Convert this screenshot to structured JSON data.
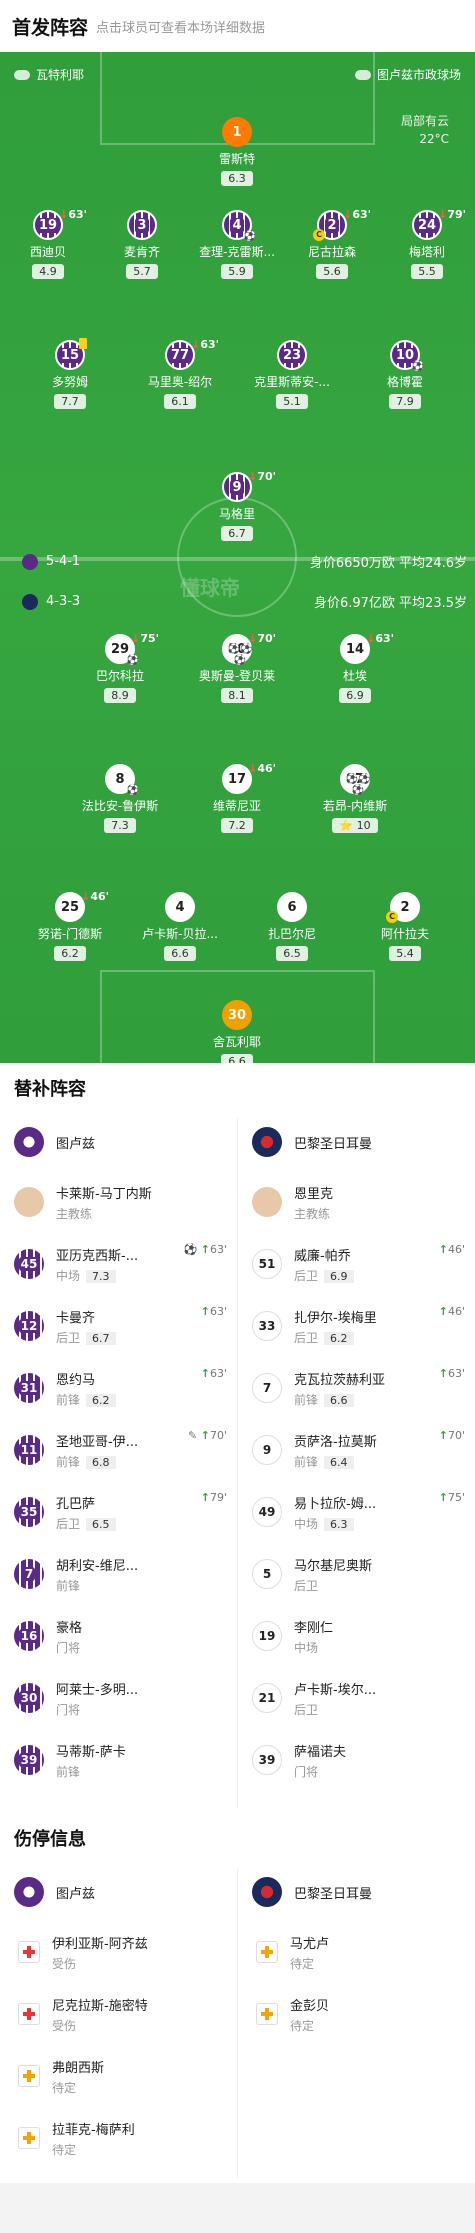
{
  "header": {
    "title": "首发阵容",
    "subtitle": "点击球员可查看本场详细数据"
  },
  "pitch": {
    "referee": "瓦特利耶",
    "stadium": "图卢兹市政球场",
    "weather": "局部有云",
    "temperature": "22°C",
    "watermark": "懂球帝",
    "home": {
      "formation": "5-4-1",
      "value": "身价6650万欧 平均24.6岁"
    },
    "away": {
      "formation": "4-3-3",
      "value": "身价6.97亿欧 平均23.5岁"
    },
    "players": [
      {
        "num": "1",
        "name": "雷斯特",
        "rating": "6.3",
        "kit": "gk1"
      },
      {
        "num": "19",
        "name": "西迪贝",
        "rating": "4.9",
        "kit": "tol",
        "sub": "63'"
      },
      {
        "num": "3",
        "name": "麦肯齐",
        "rating": "5.7",
        "kit": "tol"
      },
      {
        "num": "4",
        "name": "查理-克雷斯...",
        "rating": "5.9",
        "kit": "tol",
        "ball": "⚽"
      },
      {
        "num": "2",
        "name": "尼古拉森",
        "rating": "5.6",
        "kit": "tol",
        "sub": "63'",
        "capt": "C"
      },
      {
        "num": "24",
        "name": "梅塔利",
        "rating": "5.5",
        "kit": "tol",
        "sub": "79'"
      },
      {
        "num": "15",
        "name": "多努姆",
        "rating": "7.7",
        "kit": "tol",
        "yc": true
      },
      {
        "num": "77",
        "name": "马里奥-绍尔",
        "rating": "6.1",
        "kit": "tol",
        "sub": "63'"
      },
      {
        "num": "23",
        "name": "克里斯蒂安-...",
        "rating": "5.1",
        "kit": "tol"
      },
      {
        "num": "10",
        "name": "格博霍",
        "rating": "7.9",
        "kit": "tol",
        "ball": "⚽"
      },
      {
        "num": "9",
        "name": "马格里",
        "rating": "6.7",
        "kit": "tol",
        "sub": "70'"
      },
      {
        "num": "29",
        "name": "巴尔科拉",
        "rating": "8.9",
        "kit": "psg",
        "sub": "75'",
        "ball": "⚽"
      },
      {
        "num": "10",
        "name": "奥斯曼-登贝莱",
        "rating": "8.1",
        "kit": "psg",
        "sub": "70'",
        "ball": "⚽⚽⚽"
      },
      {
        "num": "14",
        "name": "杜埃",
        "rating": "6.9",
        "kit": "psg",
        "sub": "63'"
      },
      {
        "num": "8",
        "name": "法比安-鲁伊斯",
        "rating": "7.3",
        "kit": "psg",
        "ball": "⚽"
      },
      {
        "num": "17",
        "name": "维蒂尼亚",
        "rating": "7.2",
        "kit": "psg",
        "sub": "46'"
      },
      {
        "num": "87",
        "name": "若昂-内维斯",
        "rating": "10",
        "kit": "psg",
        "ball": "⚽⚽⚽",
        "star": "⭐"
      },
      {
        "num": "25",
        "name": "努诺-门德斯",
        "rating": "6.2",
        "kit": "psg",
        "sub": "46'"
      },
      {
        "num": "4",
        "name": "卢卡斯-贝拉...",
        "rating": "6.6",
        "kit": "psg"
      },
      {
        "num": "6",
        "name": "扎巴尔尼",
        "rating": "6.5",
        "kit": "psg"
      },
      {
        "num": "2",
        "name": "阿什拉夫",
        "rating": "5.4",
        "kit": "psg",
        "capt": "C"
      },
      {
        "num": "30",
        "name": "舍瓦利耶",
        "rating": "6.6",
        "kit": "gk2"
      }
    ]
  },
  "subs": {
    "title": "替补阵容",
    "home_team": "图卢兹",
    "away_team": "巴黎圣日耳曼",
    "home": [
      {
        "num": "",
        "name": "卡莱斯-马丁内斯",
        "pos": "主教练",
        "coach": true
      },
      {
        "num": "45",
        "name": "亚历克西斯-...",
        "pos": "中场",
        "rating": "7.3",
        "sub": "63'",
        "extra": "⚽"
      },
      {
        "num": "12",
        "name": "卡曼齐",
        "pos": "后卫",
        "rating": "6.7",
        "sub": "63'"
      },
      {
        "num": "31",
        "name": "恩约马",
        "pos": "前锋",
        "rating": "6.2",
        "sub": "63'"
      },
      {
        "num": "11",
        "name": "圣地亚哥-伊...",
        "pos": "前锋",
        "rating": "6.8",
        "sub": "70'",
        "extra": "✎"
      },
      {
        "num": "35",
        "name": "孔巴萨",
        "pos": "后卫",
        "rating": "6.5",
        "sub": "79'"
      },
      {
        "num": "7",
        "name": "胡利安-维尼...",
        "pos": "前锋"
      },
      {
        "num": "16",
        "name": "豪格",
        "pos": "门将"
      },
      {
        "num": "30",
        "name": "阿莱士-多明...",
        "pos": "门将"
      },
      {
        "num": "39",
        "name": "马蒂斯-萨卡",
        "pos": "前锋"
      }
    ],
    "away": [
      {
        "num": "",
        "name": "恩里克",
        "pos": "主教练",
        "coach": true
      },
      {
        "num": "51",
        "name": "威廉-帕乔",
        "pos": "后卫",
        "rating": "6.9",
        "sub": "46'"
      },
      {
        "num": "33",
        "name": "扎伊尔-埃梅里",
        "pos": "后卫",
        "rating": "6.2",
        "sub": "46'"
      },
      {
        "num": "7",
        "name": "克瓦拉茨赫利亚",
        "pos": "前锋",
        "rating": "6.6",
        "sub": "63'"
      },
      {
        "num": "9",
        "name": "贡萨洛-拉莫斯",
        "pos": "前锋",
        "rating": "6.4",
        "sub": "70'"
      },
      {
        "num": "49",
        "name": "易卜拉欣-姆...",
        "pos": "中场",
        "rating": "6.3",
        "sub": "75'"
      },
      {
        "num": "5",
        "name": "马尔基尼奥斯",
        "pos": "后卫"
      },
      {
        "num": "19",
        "name": "李刚仁",
        "pos": "中场"
      },
      {
        "num": "21",
        "name": "卢卡斯-埃尔...",
        "pos": "后卫"
      },
      {
        "num": "39",
        "name": "萨福诺夫",
        "pos": "门将"
      }
    ]
  },
  "injuries": {
    "title": "伤停信息",
    "home_team": "图卢兹",
    "away_team": "巴黎圣日耳曼",
    "home": [
      {
        "name": "伊利亚斯-阿齐兹",
        "status": "受伤",
        "type": "red"
      },
      {
        "name": "尼克拉斯-施密特",
        "status": "受伤",
        "type": "red"
      },
      {
        "name": "弗朗西斯",
        "status": "待定",
        "type": "orange"
      },
      {
        "name": "拉菲克-梅萨利",
        "status": "待定",
        "type": "orange"
      }
    ],
    "away": [
      {
        "name": "马尤卢",
        "status": "待定",
        "type": "orange"
      },
      {
        "name": "金彭贝",
        "status": "待定",
        "type": "orange"
      }
    ]
  }
}
